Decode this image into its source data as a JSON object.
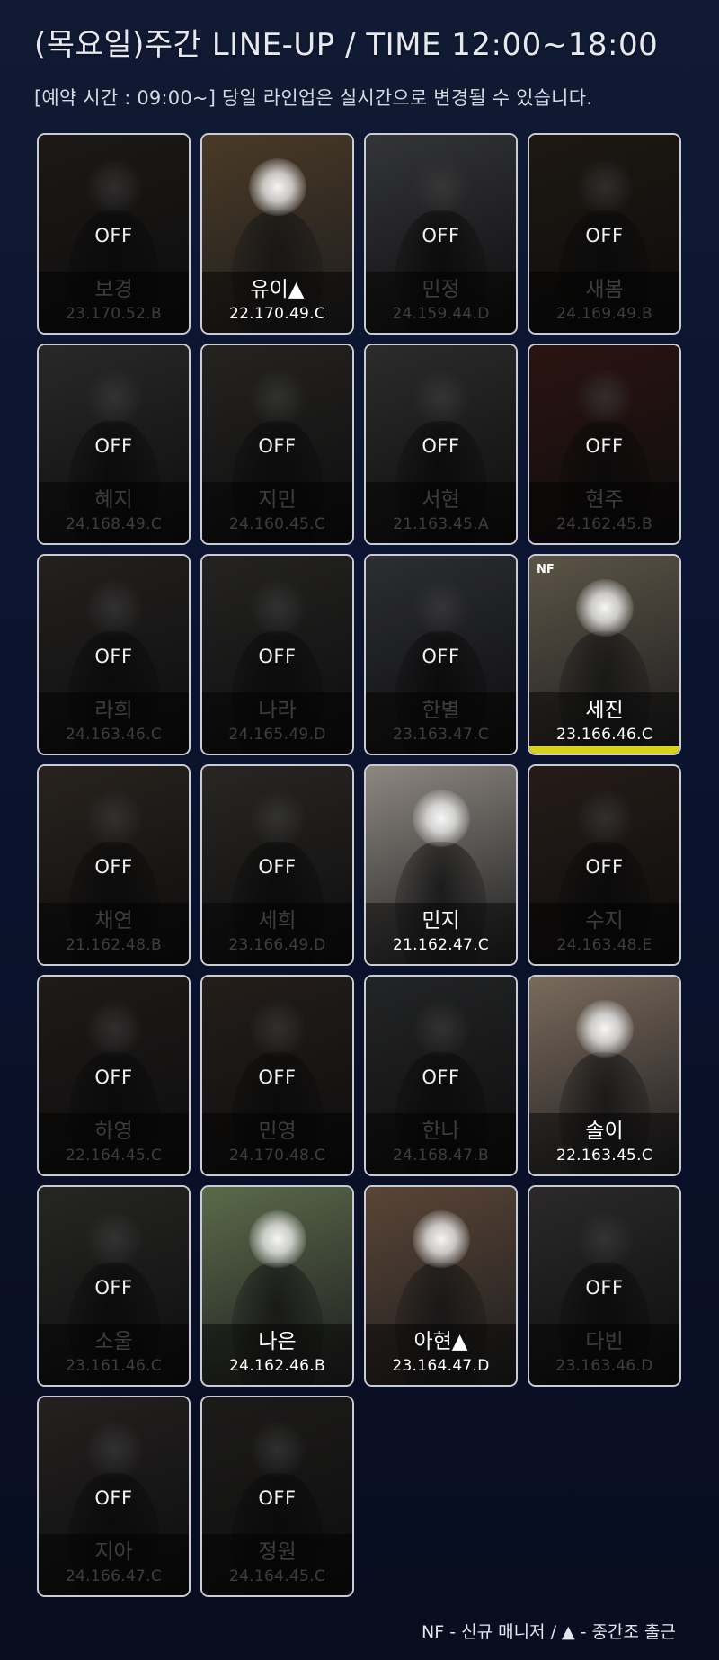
{
  "header": {
    "title": "(목요일)주간 LINE-UP / TIME 12:00~18:00",
    "subtitle": "[예약 시간 : 09:00~] 당일 라인업은 실시간으로 변경될 수 있습니다."
  },
  "off_label": "OFF",
  "nf_tag": "NF",
  "cards": [
    {
      "name": "보경",
      "stats": "23.170.52.B",
      "status": "off",
      "tone": "#3b3530"
    },
    {
      "name": "유이▲",
      "stats": "22.170.49.C",
      "status": "on",
      "tone": "#4a3a26"
    },
    {
      "name": "민정",
      "stats": "24.159.44.D",
      "status": "off",
      "tone": "#6d6f74"
    },
    {
      "name": "새봄",
      "stats": "24.169.49.B",
      "status": "off",
      "tone": "#3e3226"
    },
    {
      "name": "혜지",
      "stats": "24.168.49.C",
      "status": "off",
      "tone": "#555557"
    },
    {
      "name": "지민",
      "stats": "24.160.45.C",
      "status": "off",
      "tone": "#4d4a44"
    },
    {
      "name": "서현",
      "stats": "21.163.45.A",
      "status": "off",
      "tone": "#5b5b5d"
    },
    {
      "name": "현주",
      "stats": "24.162.45.B",
      "status": "off",
      "tone": "#5a2a26"
    },
    {
      "name": "라희",
      "stats": "24.163.46.C",
      "status": "off",
      "tone": "#4a4541"
    },
    {
      "name": "나라",
      "stats": "24.165.49.D",
      "status": "off",
      "tone": "#4c4a46"
    },
    {
      "name": "한별",
      "stats": "23.163.47.C",
      "status": "off",
      "tone": "#5d6068"
    },
    {
      "name": "세진",
      "stats": "23.166.46.C",
      "status": "on",
      "tone": "#5c5446",
      "nf": true,
      "strip": true
    },
    {
      "name": "채연",
      "stats": "21.162.48.B",
      "status": "off",
      "tone": "#54493f"
    },
    {
      "name": "세희",
      "stats": "23.166.49.D",
      "status": "off",
      "tone": "#55504a"
    },
    {
      "name": "민지",
      "stats": "21.162.47.C",
      "status": "on",
      "tone": "#8d8780"
    },
    {
      "name": "수지",
      "stats": "24.163.48.E",
      "status": "off",
      "tone": "#4f3b33"
    },
    {
      "name": "하영",
      "stats": "22.164.45.C",
      "status": "off",
      "tone": "#3f3833"
    },
    {
      "name": "민영",
      "stats": "24.170.48.C",
      "status": "off",
      "tone": "#4a3f36"
    },
    {
      "name": "한나",
      "stats": "24.168.47.B",
      "status": "off",
      "tone": "#4a4c4e"
    },
    {
      "name": "솔이",
      "stats": "22.163.45.C",
      "status": "on",
      "tone": "#7a6a5c"
    },
    {
      "name": "소울",
      "stats": "23.161.46.C",
      "status": "off",
      "tone": "#4f504b"
    },
    {
      "name": "나은",
      "stats": "24.162.46.B",
      "status": "on",
      "tone": "#5b6a4a"
    },
    {
      "name": "아현▲",
      "stats": "23.164.47.D",
      "status": "on",
      "tone": "#5a4536"
    },
    {
      "name": "다빈",
      "stats": "23.163.46.D",
      "status": "off",
      "tone": "#5a5656"
    },
    {
      "name": "지아",
      "stats": "24.166.47.C",
      "status": "off",
      "tone": "#4b4542"
    },
    {
      "name": "정원",
      "stats": "24.164.45.C",
      "status": "off",
      "tone": "#3d3a36"
    }
  ],
  "footer": {
    "legend": "NF - 신규 매니저 / ▲ - 중간조 출근"
  }
}
